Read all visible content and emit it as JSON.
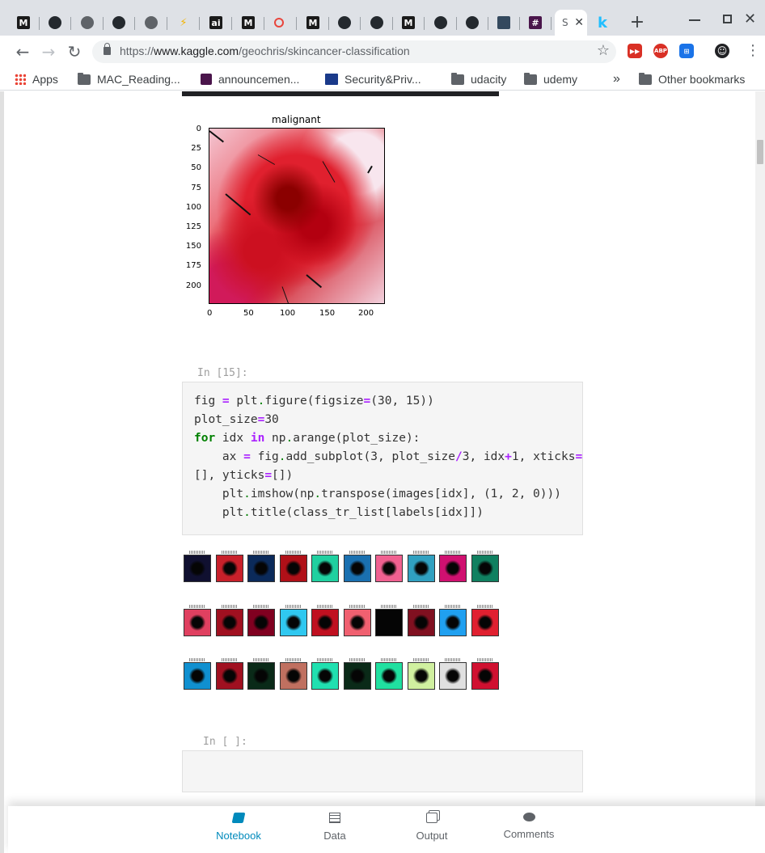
{
  "browser": {
    "tabs": [
      {
        "icon": "medium-icon",
        "glyph": "M",
        "bg": "#1a1a1a"
      },
      {
        "icon": "github-icon",
        "glyph": "",
        "bg": "#24292e"
      },
      {
        "icon": "globe-icon",
        "glyph": "",
        "bg": "#5f6368"
      },
      {
        "icon": "github-icon",
        "glyph": "",
        "bg": "#24292e"
      },
      {
        "icon": "globe-icon",
        "glyph": "",
        "bg": "#5f6368"
      },
      {
        "icon": "lightning-icon",
        "glyph": "⚡",
        "bg": "#dee1e6"
      },
      {
        "icon": "ai-icon",
        "glyph": "ai",
        "bg": "#1a1a1a"
      },
      {
        "icon": "medium-icon",
        "glyph": "M",
        "bg": "#1a1a1a"
      },
      {
        "icon": "refresh-red-icon",
        "glyph": "",
        "bg": "#dee1e6"
      },
      {
        "icon": "medium-icon",
        "glyph": "M",
        "bg": "#1a1a1a"
      },
      {
        "icon": "github-icon",
        "glyph": "",
        "bg": "#24292e"
      },
      {
        "icon": "github-icon",
        "glyph": "",
        "bg": "#24292e"
      },
      {
        "icon": "medium-icon",
        "glyph": "M",
        "bg": "#1a1a1a"
      },
      {
        "icon": "github-icon",
        "glyph": "",
        "bg": "#24292e"
      },
      {
        "icon": "github-icon",
        "glyph": "",
        "bg": "#24292e"
      },
      {
        "icon": "doc-icon",
        "glyph": "",
        "bg": "#34495e"
      },
      {
        "icon": "slack-icon",
        "glyph": "#",
        "bg": "#4a154b"
      }
    ],
    "active_tab_letter": "S",
    "kaggle_tab_glyph": "k",
    "new_tab": "+",
    "url_scheme": "https://",
    "url_host": "www.kaggle.com",
    "url_path": "/geochris/skincancer-classification",
    "back": "←",
    "forward": "→",
    "reload": "↻",
    "star": "☆",
    "menu": "⋮",
    "extensions": [
      {
        "name": "red-fast-forward-icon",
        "label": "▶▶",
        "bg": "#d93025"
      },
      {
        "name": "adblock-plus-icon",
        "label": "ABP",
        "bg": "#d93025"
      },
      {
        "name": "translate-icon",
        "label": "⊞",
        "bg": "#1a73e8"
      },
      {
        "name": "avatar-icon",
        "label": "☺",
        "bg": "#202124"
      }
    ]
  },
  "bookmarks": {
    "apps": "Apps",
    "items": [
      "MAC_Reading...",
      "announcemen...",
      "Security&Priv...",
      "udacity",
      "udemy"
    ],
    "overflow": "»",
    "other": "Other bookmarks"
  },
  "plot": {
    "title": "malignant",
    "yticks": [
      "0",
      "25",
      "50",
      "75",
      "100",
      "125",
      "150",
      "175",
      "200"
    ],
    "xticks": [
      "0",
      "50",
      "100",
      "150",
      "200"
    ]
  },
  "cell15": {
    "prompt": "In [15]:",
    "lines": [
      "fig = plt.figure(figsize=(30, 15))",
      "plot_size=30",
      "for idx in np.arange(plot_size):",
      "    ax = fig.add_subplot(3, plot_size/3, idx+1, xticks=",
      "[], yticks=[])",
      "    plt.imshow(np.transpose(images[idx], (1, 2, 0)))",
      "    plt.title(class_tr_list[labels[idx]])"
    ]
  },
  "grid": {
    "thumbs": [
      [
        "#101030",
        "#c8202a",
        "#0b2a5a",
        "#b01018",
        "#20d0a0",
        "#1a70b0",
        "#f06090",
        "#30a0c0",
        "#d01070",
        "#108060"
      ],
      [
        "#e04060",
        "#a01020",
        "#800020",
        "#30c8f0",
        "#c01020",
        "#f06070",
        "#050505",
        "#801020",
        "#20a0f0",
        "#e02030"
      ],
      [
        "#1090d0",
        "#a01020",
        "#0a2a18",
        "#c07060",
        "#20e0b0",
        "#0a2a18",
        "#20e0a0",
        "#d0f0a0",
        "#e0e0e0",
        "#d01030"
      ]
    ]
  },
  "cell_empty": {
    "prompt": "In [ ]:"
  },
  "bottom_tabs": [
    {
      "label": "Notebook",
      "icon": "notebook-icon",
      "active": true
    },
    {
      "label": "Data",
      "icon": "data-table-icon",
      "active": false
    },
    {
      "label": "Output",
      "icon": "output-icon",
      "active": false
    },
    {
      "label": "Comments",
      "icon": "comment-icon",
      "active": false
    }
  ]
}
